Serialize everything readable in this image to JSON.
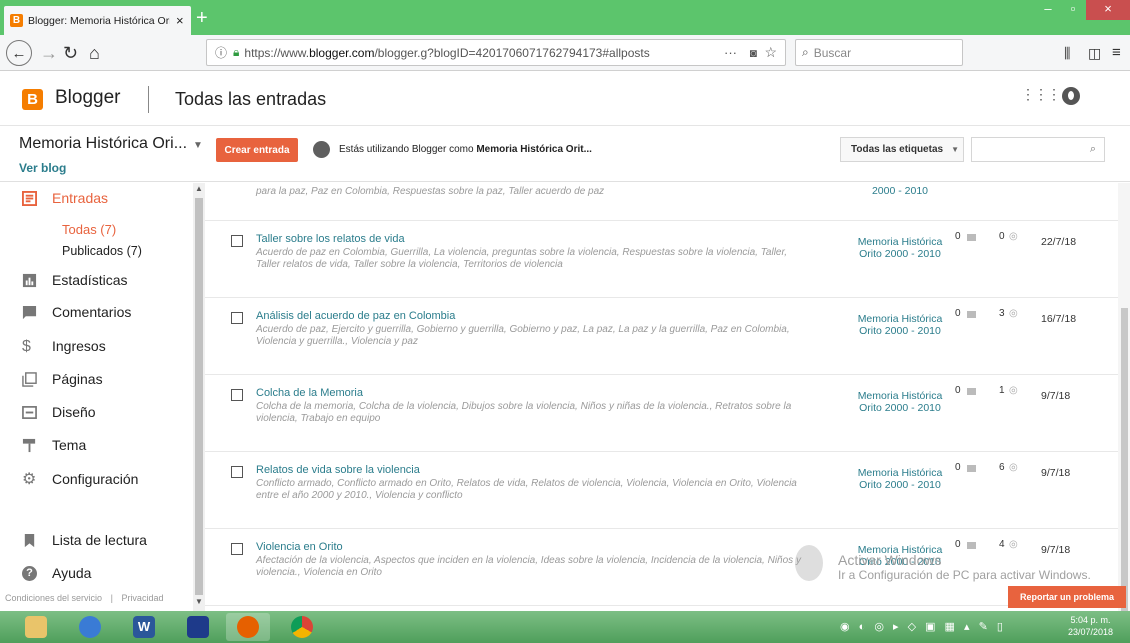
{
  "browser": {
    "tab_title": "Blogger: Memoria Histórica Ori",
    "tab_close": "×",
    "new_tab": "+",
    "url_prefix": "https://www.",
    "url_domain": "blogger.com",
    "url_rest": "/blogger.g?blogID=4201706071762794173#allposts",
    "search_placeholder": "Buscar"
  },
  "header": {
    "app_name": "Blogger",
    "page_title": "Todas las entradas"
  },
  "toolbar": {
    "blog_name": "Memoria Histórica Ori...",
    "view_blog": "Ver blog",
    "new_post": "Crear entrada",
    "using_prefix": "Estás utilizando Blogger como",
    "using_name": "Memoria Histórica Orit...",
    "labels_filter": "Todas las etiquetas"
  },
  "sidebar": {
    "entradas": "Entradas",
    "todas": "Todas (7)",
    "publicados": "Publicados (7)",
    "estadisticas": "Estadísticas",
    "comentarios": "Comentarios",
    "ingresos": "Ingresos",
    "paginas": "Páginas",
    "diseno": "Diseño",
    "tema": "Tema",
    "configuracion": "Configuración",
    "lista_lectura": "Lista de lectura",
    "ayuda": "Ayuda",
    "terms": "Condiciones del servicio",
    "privacy": "Privacidad"
  },
  "partial_row": {
    "labels": "para la paz, Paz en Colombia, Respuestas sobre la paz, Taller acuerdo de paz",
    "author_tail": "2000 - 2010"
  },
  "posts": [
    {
      "title": "Taller sobre los relatos de vida",
      "labels": "Acuerdo de paz en Colombia, Guerrilla, La violencia, preguntas sobre la violencia, Respuestas sobre la violencia, Taller, Taller relatos de vida, Taller sobre la violencia, Territorios de violencia",
      "author": "Memoria Histórica Orito 2000 - 2010",
      "comments": "0",
      "views": "0",
      "date": "22/7/18"
    },
    {
      "title": "Análisis del acuerdo de paz en Colombia",
      "labels": "Acuerdo de paz, Ejercito y guerrilla, Gobierno y guerrilla, Gobierno y paz, La paz, La paz y la guerrilla, Paz en Colombia, Violencia y guerrilla., Violencia y paz",
      "author": "Memoria Histórica Orito 2000 - 2010",
      "comments": "0",
      "views": "3",
      "date": "16/7/18"
    },
    {
      "title": "Colcha de la Memoria",
      "labels": "Colcha de la memoria, Colcha de la violencia, Dibujos sobre la violencia, Niños y niñas de la violencia., Retratos sobre la violencia, Trabajo en equipo",
      "author": "Memoria Histórica Orito 2000 - 2010",
      "comments": "0",
      "views": "1",
      "date": "9/7/18"
    },
    {
      "title": "Relatos de vida sobre la violencia",
      "labels": "Conflicto armado, Conflicto armado en Orito, Relatos de vida, Relatos de violencia, Violencia, Violencia en Orito, Violencia entre el año 2000 y 2010., Violencia y conflicto",
      "author": "Memoria Histórica Orito 2000 - 2010",
      "comments": "0",
      "views": "6",
      "date": "9/7/18"
    },
    {
      "title": "Violencia en Orito",
      "labels": "Afectación de la violencia, Aspectos que inciden en la violencia, Ideas sobre la violencia, Incidencia de la violencia, Niños y violencia., Violencia en Orito",
      "author": "Memoria Histórica Orito 2000 - 2010",
      "comments": "0",
      "views": "4",
      "date": "9/7/18"
    }
  ],
  "watermark": {
    "line1": "Activar Windows",
    "line2": "Ir a Configuración de PC para activar Windows."
  },
  "report_button": "Reportar un problema",
  "taskbar": {
    "time": "5:04 p. m.",
    "date": "23/07/2018"
  },
  "colors": {
    "accent": "#e8633e",
    "link": "#2b7d8c",
    "blogger_orange": "#f57d00",
    "titlebar": "#5cc56c"
  }
}
